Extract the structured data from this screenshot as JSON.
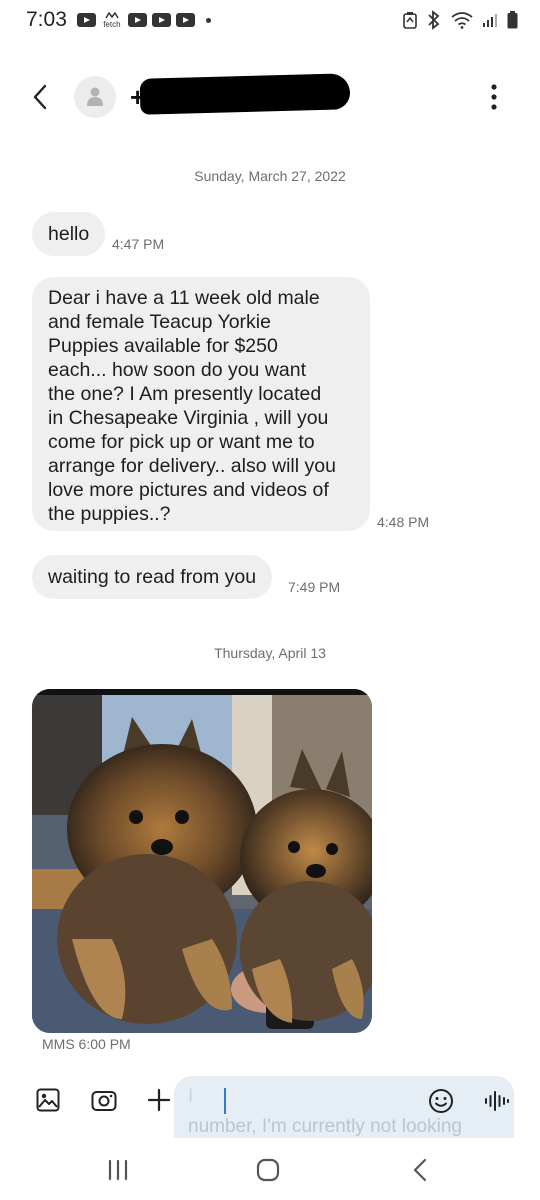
{
  "status_bar": {
    "time": "7:03",
    "notification_icons": [
      "youtube-icon",
      "fetch-icon",
      "youtube-icon",
      "youtube-icon",
      "youtube-icon"
    ],
    "fetch_label": "fetch"
  },
  "header": {
    "contact_name": "+",
    "back_icon": "chevron-left-icon",
    "more_icon": "more-vertical-icon"
  },
  "conversation": {
    "date_1": "Sunday, March 27, 2022",
    "messages_1": [
      {
        "text": "hello",
        "time": "4:47 PM"
      },
      {
        "lines": [
          "Dear i have a 11 week old  male",
          "and female Teacup Yorkie",
          "Puppies available for $250",
          "each... how soon do you want",
          "the one? I Am presently located",
          "in Chesapeake Virginia , will you",
          "come for pick up or want me to",
          "arrange for delivery.. also will you",
          "love more pictures and videos of",
          "the puppies..?"
        ],
        "time": "4:48 PM"
      },
      {
        "text": "waiting to read from you",
        "time": "7:49 PM"
      }
    ],
    "date_2": "Thursday, April 13",
    "mms": {
      "label": "MMS 6:00 PM",
      "image": "two-yorkie-puppies"
    }
  },
  "compose": {
    "ghost_top": "I",
    "ghost_bottom": "number, I'm currently not looking"
  },
  "colors": {
    "bubble": "#efefef",
    "accent": "#2e7bd6",
    "secondary_text": "#6e6e6e"
  }
}
